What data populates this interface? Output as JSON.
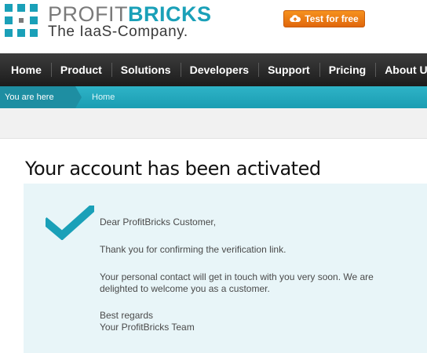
{
  "brand": {
    "name_part1": "PROFIT",
    "name_part2": "BRICKS",
    "tagline": "The IaaS-Company."
  },
  "cta": {
    "label": "Test for free",
    "icon": "cloud-upload-icon"
  },
  "nav": {
    "items": [
      {
        "label": "Home"
      },
      {
        "label": "Product"
      },
      {
        "label": "Solutions"
      },
      {
        "label": "Developers"
      },
      {
        "label": "Support"
      },
      {
        "label": "Pricing"
      },
      {
        "label": "About Us"
      }
    ]
  },
  "breadcrumb": {
    "you_are_here": "You are here",
    "home": "Home"
  },
  "page": {
    "title": "Your account has been activated"
  },
  "message": {
    "greeting": "Dear ProfitBricks Customer,",
    "thanks": "Thank you for confirming the verification link.",
    "contact_line1": "Your personal contact will get in touch with you very soon. We are",
    "contact_line2": "delighted to welcome you as a customer.",
    "regards": "Best regards",
    "team": "Your ProfitBricks Team",
    "icon": "checkmark-icon"
  },
  "colors": {
    "accent": "#1aa0b8",
    "cta": "#f08018",
    "nav_bg": "#2a2a2a",
    "panel_bg": "#e8f5f8"
  }
}
